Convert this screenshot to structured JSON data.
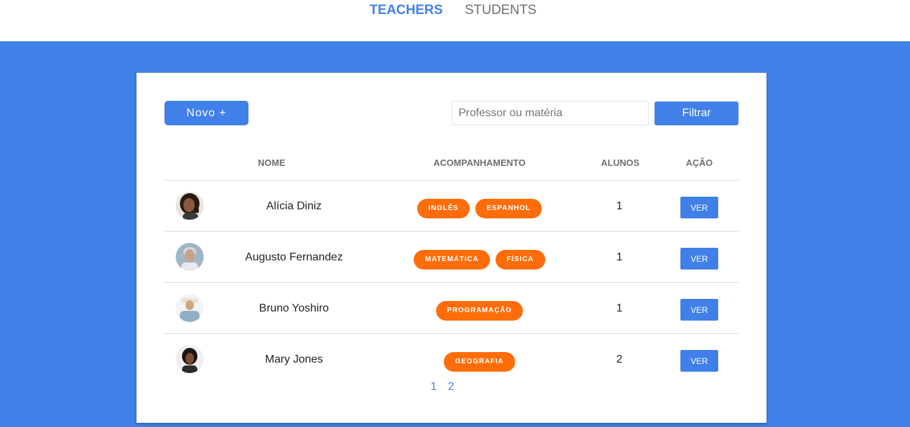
{
  "nav": {
    "tabs": [
      {
        "label": "TEACHERS",
        "active": true
      },
      {
        "label": "STUDENTS",
        "active": false
      }
    ]
  },
  "colors": {
    "accent": "#4080e8",
    "tag": "#ff6d0a",
    "muted": "#6f6f6f"
  },
  "toolbar": {
    "new_label": "Novo +",
    "search_placeholder": "Professor ou matéria",
    "search_value": "",
    "filter_label": "Filtrar"
  },
  "table": {
    "headers": [
      "NOME",
      "ACOMPANHAMENTO",
      "ALUNOS",
      "AÇÃO"
    ],
    "rows": [
      {
        "name": "Alícia Diniz",
        "subjects": [
          "INGLÊS",
          "ESPANHOL"
        ],
        "students": "1",
        "action": "VER",
        "avatar": "avatar-icon"
      },
      {
        "name": "Augusto Fernandez",
        "subjects": [
          "MATEMÁTICA",
          "FÍSICA"
        ],
        "students": "1",
        "action": "VER",
        "avatar": "avatar-icon"
      },
      {
        "name": "Bruno Yoshiro",
        "subjects": [
          "PROGRAMAÇÃO"
        ],
        "students": "1",
        "action": "VER",
        "avatar": "avatar-icon"
      },
      {
        "name": "Mary Jones",
        "subjects": [
          "GEOGRAFIA"
        ],
        "students": "2",
        "action": "VER",
        "avatar": "avatar-icon"
      }
    ]
  },
  "pagination": {
    "pages": [
      "1",
      "2"
    ]
  }
}
